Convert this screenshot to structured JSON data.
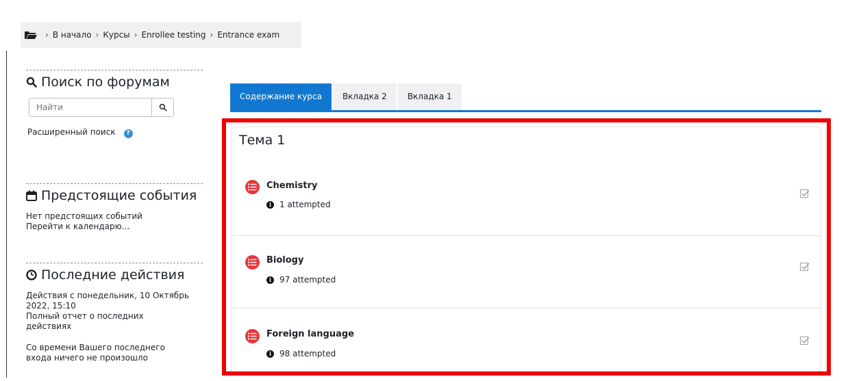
{
  "breadcrumb": {
    "items": [
      "В начало",
      "Курсы",
      "Enrollee testing",
      "Entrance exam"
    ],
    "separator": "›"
  },
  "sidebar": {
    "search": {
      "title": "Поиск по форумам",
      "placeholder": "Найти",
      "advanced_label": "Расширенный поиск"
    },
    "events": {
      "title": "Предстоящие события",
      "none_text": "Нет предстоящих событий",
      "calendar_link": "Перейти к календарю..."
    },
    "activity": {
      "title": "Последние действия",
      "since_text": "Действия с понедельник, 10 Октябрь 2022, 15:10",
      "full_report_link": "Полный отчет о последних действиях",
      "nothing_text": "Со времени Вашего последнего входа ничего не произошло"
    }
  },
  "tabs": [
    {
      "label": "Содержание курса",
      "active": true
    },
    {
      "label": "Вкладка 2",
      "active": false
    },
    {
      "label": "Вкладка 1",
      "active": false
    }
  ],
  "section": {
    "title": "Тема 1",
    "activities": [
      {
        "name": "Chemistry",
        "info": "1 attempted",
        "icon": "quiz-icon"
      },
      {
        "name": "Biology",
        "info": "97 attempted",
        "icon": "quiz-icon"
      },
      {
        "name": "Foreign language",
        "info": "98 attempted",
        "icon": "quiz-icon"
      }
    ]
  },
  "colors": {
    "accent": "#1177d1",
    "highlight_outline": "#f00000",
    "quiz_icon": "#e6373c"
  }
}
